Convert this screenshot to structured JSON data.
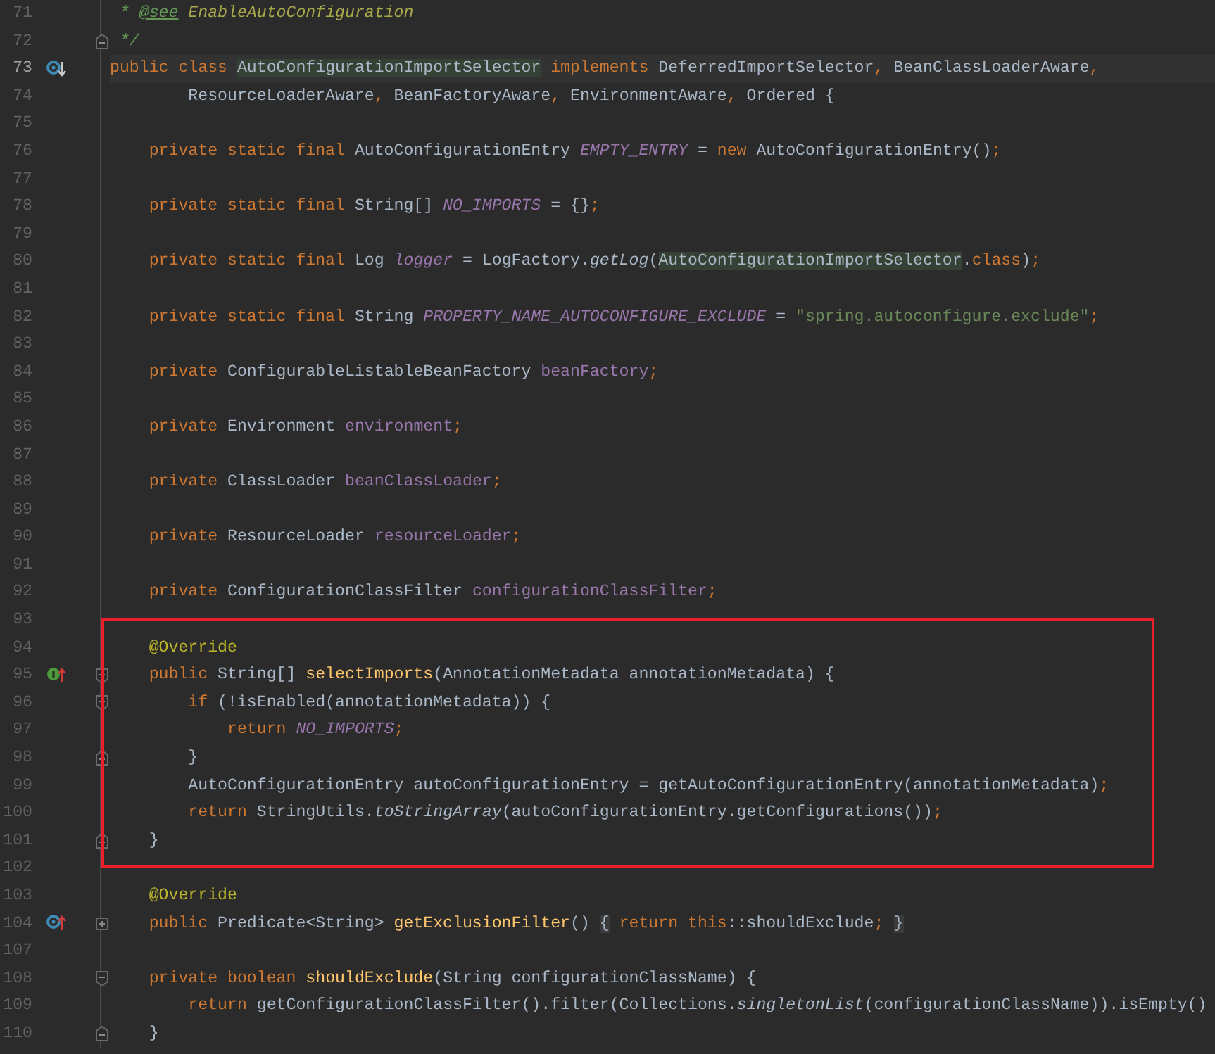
{
  "lines": [
    {
      "number": "71",
      "current": false,
      "boxed": false,
      "tokens": [
        {
          "text": " * ",
          "kind": "doc"
        },
        {
          "text": "@see",
          "kind": "doctag"
        },
        {
          "text": " EnableAutoConfiguration",
          "kind": "docref"
        }
      ]
    },
    {
      "number": "72",
      "current": false,
      "boxed": false,
      "fold": {
        "kind": "end"
      },
      "tokens": [
        {
          "text": " */",
          "kind": "doc"
        }
      ]
    },
    {
      "number": "73",
      "current": true,
      "boxed": false,
      "gutter_icon": {
        "kind": "implemented"
      },
      "tokens": [
        {
          "text": "public class ",
          "kind": "kw"
        },
        {
          "text": "AutoConfigurationImportSelector",
          "kind": "usage"
        },
        {
          "text": " implements ",
          "kind": "kw"
        },
        {
          "text": "DeferredImportSelector",
          "kind": "plain"
        },
        {
          "text": ", ",
          "kind": "kw"
        },
        {
          "text": "BeanClassLoaderAware",
          "kind": "plain"
        },
        {
          "text": ",",
          "kind": "kw"
        }
      ]
    },
    {
      "number": "74",
      "current": false,
      "boxed": false,
      "tokens": [
        {
          "text": "        ResourceLoaderAware",
          "kind": "plain"
        },
        {
          "text": ", ",
          "kind": "kw"
        },
        {
          "text": "BeanFactoryAware",
          "kind": "plain"
        },
        {
          "text": ", ",
          "kind": "kw"
        },
        {
          "text": "EnvironmentAware",
          "kind": "plain"
        },
        {
          "text": ", ",
          "kind": "kw"
        },
        {
          "text": "Ordered {",
          "kind": "plain"
        }
      ]
    },
    {
      "number": "75",
      "current": false,
      "boxed": false
    },
    {
      "number": "76",
      "current": false,
      "boxed": false,
      "tokens": [
        {
          "text": "    private static final ",
          "kind": "kw"
        },
        {
          "text": "AutoConfigurationEntry ",
          "kind": "plain"
        },
        {
          "text": "EMPTY_ENTRY",
          "kind": "field"
        },
        {
          "text": " = ",
          "kind": "plain"
        },
        {
          "text": "new ",
          "kind": "kw"
        },
        {
          "text": "AutoConfigurationEntry()",
          "kind": "plain"
        },
        {
          "text": ";",
          "kind": "kw"
        }
      ]
    },
    {
      "number": "77",
      "current": false,
      "boxed": false
    },
    {
      "number": "78",
      "current": false,
      "boxed": false,
      "tokens": [
        {
          "text": "    private static final ",
          "kind": "kw"
        },
        {
          "text": "String[] ",
          "kind": "plain"
        },
        {
          "text": "NO_IMPORTS",
          "kind": "field"
        },
        {
          "text": " = {}",
          "kind": "plain"
        },
        {
          "text": ";",
          "kind": "kw"
        }
      ]
    },
    {
      "number": "79",
      "current": false,
      "boxed": false
    },
    {
      "number": "80",
      "current": false,
      "boxed": false,
      "tokens": [
        {
          "text": "    private static final ",
          "kind": "kw"
        },
        {
          "text": "Log ",
          "kind": "plain"
        },
        {
          "text": "logger",
          "kind": "field"
        },
        {
          "text": " = LogFactory.",
          "kind": "plain"
        },
        {
          "text": "getLog",
          "kind": "static"
        },
        {
          "text": "(",
          "kind": "plain"
        },
        {
          "text": "AutoConfigurationImportSelector",
          "kind": "usage"
        },
        {
          "text": ".",
          "kind": "plain"
        },
        {
          "text": "class",
          "kind": "kw"
        },
        {
          "text": ")",
          "kind": "plain"
        },
        {
          "text": ";",
          "kind": "kw"
        }
      ]
    },
    {
      "number": "81",
      "current": false,
      "boxed": false
    },
    {
      "number": "82",
      "current": false,
      "boxed": false,
      "tokens": [
        {
          "text": "    private static final ",
          "kind": "kw"
        },
        {
          "text": "String ",
          "kind": "plain"
        },
        {
          "text": "PROPERTY_NAME_AUTOCONFIGURE_EXCLUDE",
          "kind": "field"
        },
        {
          "text": " = ",
          "kind": "plain"
        },
        {
          "text": "\"spring.autoconfigure.exclude\"",
          "kind": "str"
        },
        {
          "text": ";",
          "kind": "kw"
        }
      ]
    },
    {
      "number": "83",
      "current": false,
      "boxed": false
    },
    {
      "number": "84",
      "current": false,
      "boxed": false,
      "tokens": [
        {
          "text": "    private ",
          "kind": "kw"
        },
        {
          "text": "ConfigurableListableBeanFactory ",
          "kind": "plain"
        },
        {
          "text": "beanFactory",
          "kind": "member"
        },
        {
          "text": ";",
          "kind": "kw"
        }
      ]
    },
    {
      "number": "85",
      "current": false,
      "boxed": false
    },
    {
      "number": "86",
      "current": false,
      "boxed": false,
      "tokens": [
        {
          "text": "    private ",
          "kind": "kw"
        },
        {
          "text": "Environment ",
          "kind": "plain"
        },
        {
          "text": "environment",
          "kind": "member"
        },
        {
          "text": ";",
          "kind": "kw"
        }
      ]
    },
    {
      "number": "87",
      "current": false,
      "boxed": false
    },
    {
      "number": "88",
      "current": false,
      "boxed": false,
      "tokens": [
        {
          "text": "    private ",
          "kind": "kw"
        },
        {
          "text": "ClassLoader ",
          "kind": "plain"
        },
        {
          "text": "beanClassLoader",
          "kind": "member"
        },
        {
          "text": ";",
          "kind": "kw"
        }
      ]
    },
    {
      "number": "89",
      "current": false,
      "boxed": false
    },
    {
      "number": "90",
      "current": false,
      "boxed": false,
      "tokens": [
        {
          "text": "    private ",
          "kind": "kw"
        },
        {
          "text": "ResourceLoader ",
          "kind": "plain"
        },
        {
          "text": "resourceLoader",
          "kind": "member"
        },
        {
          "text": ";",
          "kind": "kw"
        }
      ]
    },
    {
      "number": "91",
      "current": false,
      "boxed": false
    },
    {
      "number": "92",
      "current": false,
      "boxed": false,
      "tokens": [
        {
          "text": "    private ",
          "kind": "kw"
        },
        {
          "text": "ConfigurationClassFilter ",
          "kind": "plain"
        },
        {
          "text": "configurationClassFilter",
          "kind": "member"
        },
        {
          "text": ";",
          "kind": "kw"
        }
      ]
    },
    {
      "number": "93",
      "current": false,
      "boxed": false
    },
    {
      "number": "94",
      "current": false,
      "boxed": true,
      "tokens": [
        {
          "text": "    @Override",
          "kind": "annot"
        }
      ]
    },
    {
      "number": "95",
      "current": false,
      "boxed": true,
      "gutter_icon": {
        "kind": "implements"
      },
      "fold": {
        "kind": "start"
      },
      "tokens": [
        {
          "text": "    public ",
          "kind": "kw"
        },
        {
          "text": "String[] ",
          "kind": "plain"
        },
        {
          "text": "selectImports",
          "kind": "decl"
        },
        {
          "text": "(AnnotationMetadata annotationMetadata) {",
          "kind": "plain"
        }
      ]
    },
    {
      "number": "96",
      "current": false,
      "boxed": true,
      "fold": {
        "kind": "start"
      },
      "tokens": [
        {
          "text": "        if ",
          "kind": "kw"
        },
        {
          "text": "(!isEnabled(annotationMetadata)) {",
          "kind": "plain"
        }
      ]
    },
    {
      "number": "97",
      "current": false,
      "boxed": true,
      "tokens": [
        {
          "text": "            return ",
          "kind": "kw"
        },
        {
          "text": "NO_IMPORTS",
          "kind": "field"
        },
        {
          "text": ";",
          "kind": "kw"
        }
      ]
    },
    {
      "number": "98",
      "current": false,
      "boxed": true,
      "fold": {
        "kind": "end"
      },
      "tokens": [
        {
          "text": "        }",
          "kind": "plain"
        }
      ]
    },
    {
      "number": "99",
      "current": false,
      "boxed": true,
      "tokens": [
        {
          "text": "        AutoConfigurationEntry autoConfigurationEntry = getAutoConfigurationEntry(annotationMetadata)",
          "kind": "plain"
        },
        {
          "text": ";",
          "kind": "kw"
        }
      ]
    },
    {
      "number": "100",
      "current": false,
      "boxed": true,
      "tokens": [
        {
          "text": "        return ",
          "kind": "kw"
        },
        {
          "text": "StringUtils.",
          "kind": "plain"
        },
        {
          "text": "toStringArray",
          "kind": "static"
        },
        {
          "text": "(autoConfigurationEntry.getConfigurations())",
          "kind": "plain"
        },
        {
          "text": ";",
          "kind": "kw"
        }
      ]
    },
    {
      "number": "101",
      "current": false,
      "boxed": true,
      "fold": {
        "kind": "end"
      },
      "tokens": [
        {
          "text": "    }",
          "kind": "plain"
        }
      ]
    },
    {
      "number": "102",
      "current": false,
      "boxed": false
    },
    {
      "number": "103",
      "current": false,
      "boxed": false,
      "tokens": [
        {
          "text": "    @Override",
          "kind": "annot"
        }
      ]
    },
    {
      "number": "104",
      "current": false,
      "boxed": false,
      "gutter_icon": {
        "kind": "overrides"
      },
      "fold": {
        "kind": "collapsed"
      },
      "tokens": [
        {
          "text": "    public ",
          "kind": "kw"
        },
        {
          "text": "Predicate<String> ",
          "kind": "plain"
        },
        {
          "text": "getExclusionFilter",
          "kind": "decl"
        },
        {
          "text": "() ",
          "kind": "plain"
        },
        {
          "text": "{",
          "kind": "fold"
        },
        {
          "text": " return this",
          "kind": "kw"
        },
        {
          "text": "::shouldExclude",
          "kind": "plain"
        },
        {
          "text": "; ",
          "kind": "kw"
        },
        {
          "text": "}",
          "kind": "fold"
        }
      ]
    },
    {
      "number": "107",
      "current": false,
      "boxed": false
    },
    {
      "number": "108",
      "current": false,
      "boxed": false,
      "fold": {
        "kind": "start"
      },
      "tokens": [
        {
          "text": "    private boolean ",
          "kind": "kw"
        },
        {
          "text": "shouldExclude",
          "kind": "decl"
        },
        {
          "text": "(String configurationClassName) {",
          "kind": "plain"
        }
      ]
    },
    {
      "number": "109",
      "current": false,
      "boxed": false,
      "tokens": [
        {
          "text": "        return ",
          "kind": "kw"
        },
        {
          "text": "getConfigurationClassFilter().filter(Collections.",
          "kind": "plain"
        },
        {
          "text": "singletonList",
          "kind": "static"
        },
        {
          "text": "(configurationClassName)).isEmpty()",
          "kind": "plain"
        }
      ]
    },
    {
      "number": "110",
      "current": false,
      "boxed": false,
      "fold": {
        "kind": "end"
      },
      "tokens": [
        {
          "text": "    }",
          "kind": "plain"
        }
      ]
    }
  ]
}
